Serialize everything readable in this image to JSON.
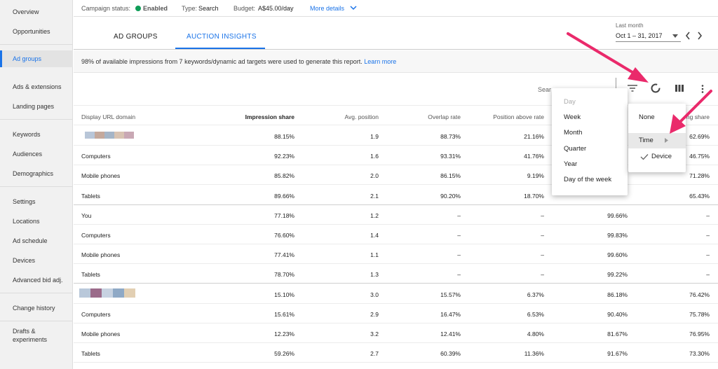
{
  "sidebar": {
    "items": [
      "Overview",
      "Opportunities",
      "Ad groups",
      "Ads & extensions",
      "Landing pages",
      "Keywords",
      "Audiences",
      "Demographics",
      "Settings",
      "Locations",
      "Ad schedule",
      "Devices",
      "Advanced bid adj.",
      "Change history",
      "Drafts &",
      "experiments"
    ]
  },
  "topbar": {
    "status_label": "Campaign status:",
    "status_value": "Enabled",
    "type_label": "Type:",
    "type_value": "Search",
    "budget_label": "Budget:",
    "budget_value": "A$45.00/day",
    "more_details": "More details"
  },
  "tabs": [
    "AD GROUPS",
    "AUCTION INSIGHTS"
  ],
  "date_range": {
    "label": "Last month",
    "value": "Oct 1 – 31, 2017"
  },
  "info": {
    "text": "98% of available impressions from 7 keywords/dynamic ad targets were used to generate this report.",
    "link": "Learn more"
  },
  "toolbar": {
    "search_label": "Sear"
  },
  "table": {
    "headers": [
      "Display URL domain",
      "Impression share",
      "Avg. position",
      "Overlap rate",
      "Position above rate",
      "",
      "ng share"
    ],
    "rows": [
      {
        "name": "",
        "imp": "88.15%",
        "pos": "1.9",
        "ovl": "88.73%",
        "above": "21.16%",
        "top": "",
        "out": "62.69%"
      },
      {
        "name": "Computers",
        "imp": "92.23%",
        "pos": "1.6",
        "ovl": "93.31%",
        "above": "41.76%",
        "top": "",
        "out": "46.75%"
      },
      {
        "name": "Mobile phones",
        "imp": "85.82%",
        "pos": "2.0",
        "ovl": "86.15%",
        "above": "9.19%",
        "top": "",
        "out": "71.28%"
      },
      {
        "name": "Tablets",
        "imp": "89.66%",
        "pos": "2.1",
        "ovl": "90.20%",
        "above": "18.70%",
        "top": "",
        "out": "65.43%"
      },
      {
        "name": "You",
        "imp": "77.18%",
        "pos": "1.2",
        "ovl": "–",
        "above": "–",
        "top": "99.66%",
        "out": "–"
      },
      {
        "name": "Computers",
        "imp": "76.60%",
        "pos": "1.4",
        "ovl": "–",
        "above": "–",
        "top": "99.83%",
        "out": "–"
      },
      {
        "name": "Mobile phones",
        "imp": "77.41%",
        "pos": "1.1",
        "ovl": "–",
        "above": "–",
        "top": "99.60%",
        "out": "–"
      },
      {
        "name": "Tablets",
        "imp": "78.70%",
        "pos": "1.3",
        "ovl": "–",
        "above": "–",
        "top": "99.22%",
        "out": "–"
      },
      {
        "name": "",
        "imp": "15.10%",
        "pos": "3.0",
        "ovl": "15.57%",
        "above": "6.37%",
        "top": "86.18%",
        "out": "76.42%"
      },
      {
        "name": "Computers",
        "imp": "15.61%",
        "pos": "2.9",
        "ovl": "16.47%",
        "above": "6.53%",
        "top": "90.40%",
        "out": "75.78%"
      },
      {
        "name": "Mobile phones",
        "imp": "12.23%",
        "pos": "3.2",
        "ovl": "12.41%",
        "above": "4.80%",
        "top": "81.67%",
        "out": "76.95%"
      },
      {
        "name": "Tablets",
        "imp": "59.26%",
        "pos": "2.7",
        "ovl": "60.39%",
        "above": "11.36%",
        "top": "91.67%",
        "out": "73.30%"
      }
    ]
  },
  "segment_menu": {
    "items": [
      "Day",
      "Week",
      "Month",
      "Quarter",
      "Year",
      "Day of the week"
    ]
  },
  "type_menu": {
    "items": [
      "None",
      "Time",
      "Device"
    ]
  },
  "colors": {
    "accent": "#1a73e8",
    "arrow": "#ea2a6b",
    "enabled_dot": "#0f9d58"
  }
}
